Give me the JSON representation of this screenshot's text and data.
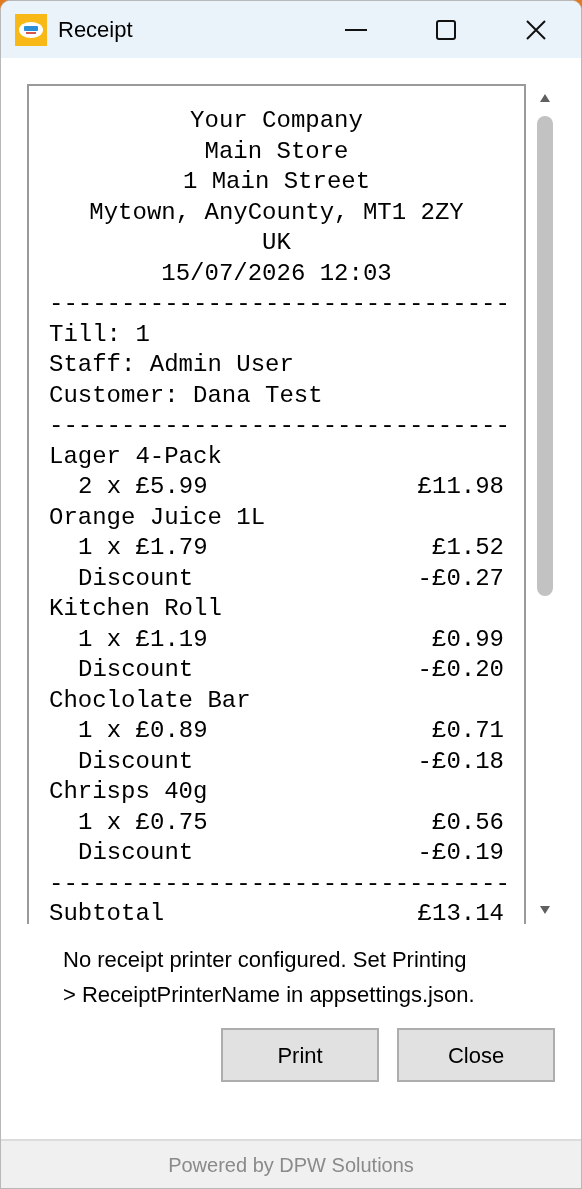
{
  "window": {
    "title": "Receipt"
  },
  "receipt": {
    "lines": [
      {
        "kind": "header",
        "text": "Your Company"
      },
      {
        "kind": "header",
        "text": "Main Store"
      },
      {
        "kind": "header",
        "text": "1 Main Street"
      },
      {
        "kind": "header",
        "text": "Mytown, AnyCounty, MT1 2ZY"
      },
      {
        "kind": "header",
        "text": "UK"
      },
      {
        "kind": "header",
        "text": "15/07/2026 12:03"
      },
      {
        "kind": "rule",
        "text": "--------------------------------"
      },
      {
        "kind": "info",
        "text": "Till: 1"
      },
      {
        "kind": "info",
        "text": "Staff: Admin User"
      },
      {
        "kind": "info",
        "text": "Customer: Dana Test"
      },
      {
        "kind": "rule",
        "text": "--------------------------------"
      },
      {
        "kind": "info",
        "text": "Lager 4-Pack"
      },
      {
        "kind": "detail",
        "text": "2 x £5.99",
        "amount": "£11.98"
      },
      {
        "kind": "info",
        "text": "Orange Juice 1L"
      },
      {
        "kind": "detail",
        "text": "1 x £1.79",
        "amount": "£1.52"
      },
      {
        "kind": "detail",
        "text": "Discount",
        "amount": "-£0.27"
      },
      {
        "kind": "info",
        "text": "Kitchen Roll"
      },
      {
        "kind": "detail",
        "text": "1 x £1.19",
        "amount": "£0.99"
      },
      {
        "kind": "detail",
        "text": "Discount",
        "amount": "-£0.20"
      },
      {
        "kind": "info",
        "text": "Choclolate Bar"
      },
      {
        "kind": "detail",
        "text": "1 x £0.89",
        "amount": "£0.71"
      },
      {
        "kind": "detail",
        "text": "Discount",
        "amount": "-£0.18"
      },
      {
        "kind": "info",
        "text": "Chrisps 40g"
      },
      {
        "kind": "detail",
        "text": "1 x £0.75",
        "amount": "£0.56"
      },
      {
        "kind": "detail",
        "text": "Discount",
        "amount": "-£0.19"
      },
      {
        "kind": "rule",
        "text": "--------------------------------"
      },
      {
        "kind": "total",
        "text": "Subtotal",
        "amount": "£13.14"
      }
    ]
  },
  "message": "No receipt printer configured. Set Printing > ReceiptPrinterName in appsettings.json.",
  "buttons": [
    "Print",
    "Close"
  ],
  "footer": "Powered by DPW Solutions"
}
